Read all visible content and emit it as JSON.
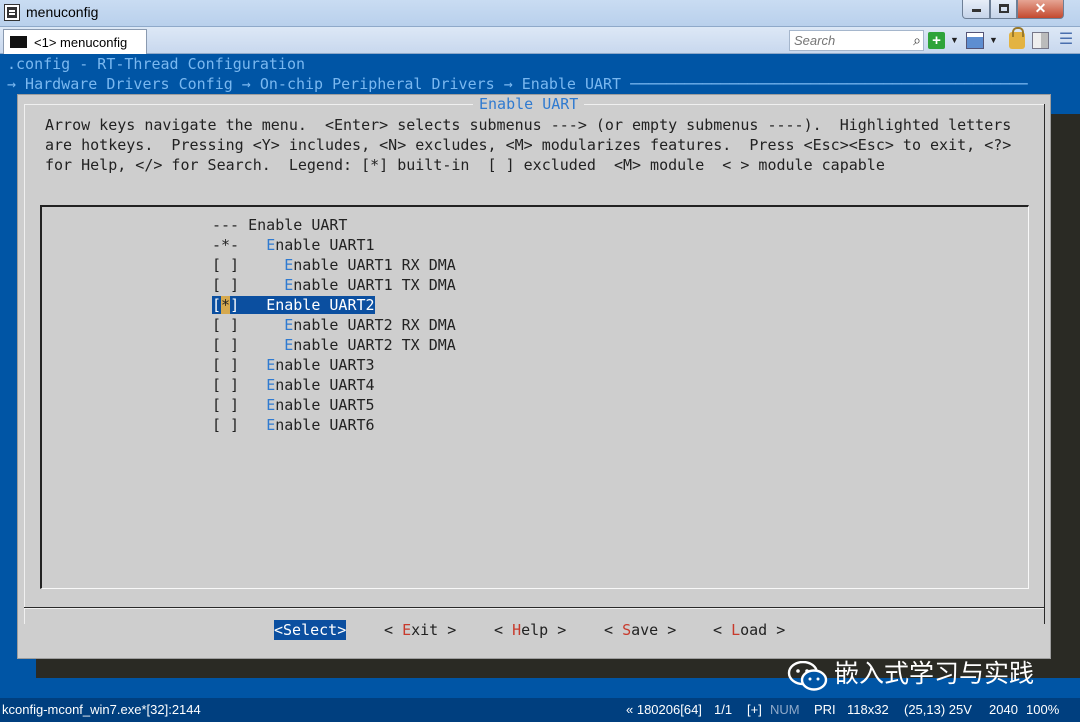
{
  "window": {
    "title": "menuconfig"
  },
  "tabbar": {
    "tab_label": "<1> menuconfig",
    "search_placeholder": "Search",
    "icons": [
      "add-icon",
      "dropdown-icon",
      "window-icon",
      "dropdown-icon",
      "lock-icon",
      "panes-icon",
      "hamburger-menu-icon"
    ]
  },
  "terminal": {
    "header_line1": ".config - RT-Thread Configuration",
    "header_line2": "→ Hardware Drivers Config → On-chip Peripheral Drivers → Enable UART ────────────────────────────────────────────",
    "dialog_title": "Enable UART",
    "help_line1": "Arrow keys navigate the menu.  <Enter> selects submenus ---> (or empty submenus ----).  Highlighted letters",
    "help_line2": "are hotkeys.  Pressing <Y> includes, <N> excludes, <M> modularizes features.  Press <Esc><Esc> to exit, <?>",
    "help_line3": "for Help, </> for Search.  Legend: [*] built-in  [ ] excluded  <M> module  < > module capable",
    "items": [
      {
        "state": "---",
        "pad": " ",
        "hot": "",
        "rest": "Enable UART"
      },
      {
        "state": "-*-",
        "pad": "   ",
        "hot": "E",
        "rest": "nable UART1"
      },
      {
        "state": "[ ]",
        "pad": "     ",
        "hot": "E",
        "rest": "nable UART1 RX DMA"
      },
      {
        "state": "[ ]",
        "pad": "     ",
        "hot": "E",
        "rest": "nable UART1 TX DMA"
      },
      {
        "state": "[*]",
        "pad": "   ",
        "hot": "E",
        "rest": "nable UART2",
        "selected": true
      },
      {
        "state": "[ ]",
        "pad": "     ",
        "hot": "E",
        "rest": "nable UART2 RX DMA"
      },
      {
        "state": "[ ]",
        "pad": "     ",
        "hot": "E",
        "rest": "nable UART2 TX DMA"
      },
      {
        "state": "[ ]",
        "pad": "   ",
        "hot": "E",
        "rest": "nable UART3"
      },
      {
        "state": "[ ]",
        "pad": "   ",
        "hot": "E",
        "rest": "nable UART4"
      },
      {
        "state": "[ ]",
        "pad": "   ",
        "hot": "E",
        "rest": "nable UART5"
      },
      {
        "state": "[ ]",
        "pad": "   ",
        "hot": "E",
        "rest": "nable UART6"
      }
    ],
    "buttons": {
      "select": "<Select>",
      "exit": {
        "pre": "< ",
        "hot": "E",
        "rest": "xit >"
      },
      "help": {
        "pre": "< ",
        "hot": "H",
        "rest": "elp >"
      },
      "save": {
        "pre": "< ",
        "hot": "S",
        "rest": "ave >"
      },
      "load": {
        "pre": "< ",
        "hot": "L",
        "rest": "oad >"
      }
    },
    "watermark": "嵌入式学习与实践"
  },
  "statusbar": {
    "process": "kconfig-mconf_win7.exe*[32]:2144",
    "buffer": "« 180206[64]",
    "page": "1/1",
    "plus": "[+]",
    "num": "NUM",
    "pri": "PRI",
    "size": "118x32",
    "cursor": "(25,13) 25V",
    "code": "2040",
    "zoom": "100%"
  },
  "colors": {
    "terminal_bg": "#0055a5",
    "dialog_bg": "#cecece",
    "hotkey_blue": "#2f7ad0",
    "button_hotkey_red": "#c83a2c",
    "selection_bg": "#0b4fa0",
    "cursor_bg": "#d6a94e"
  }
}
